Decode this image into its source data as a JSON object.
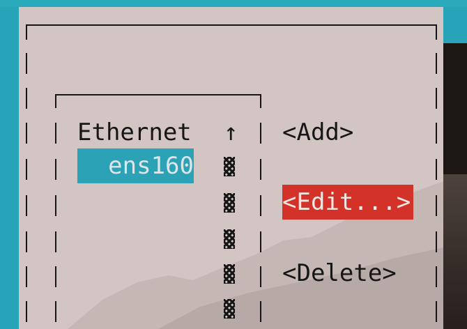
{
  "list": {
    "title": "Ethernet",
    "scroll_up_arrow": "↑",
    "items": [
      "ens160"
    ],
    "selected_index": 0
  },
  "buttons": {
    "add": "<Add>",
    "edit": "<Edit...>",
    "delete": "<Delete>"
  },
  "colors": {
    "desktop": "#27a4b8",
    "window": "#d3c5c4",
    "selection": "#2ba2b5",
    "focused_button": "#d33228"
  }
}
